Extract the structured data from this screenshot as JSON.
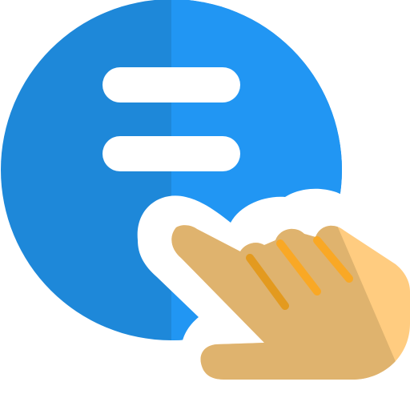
{
  "icon": {
    "name": "chat-tap-icon",
    "parts": [
      "chat-bubble-icon",
      "text-lines-icon",
      "pointing-hand-icon"
    ]
  },
  "colors": {
    "bubble_light": "#2196F3",
    "bubble_dark": "#1E88D9",
    "lines": "#ffffff",
    "outline": "#ffffff",
    "hand_light": "#FFCC80",
    "hand_dark": "#DFB36E",
    "nail_light": "#F9A825",
    "nail_dark": "#E39A1F"
  }
}
